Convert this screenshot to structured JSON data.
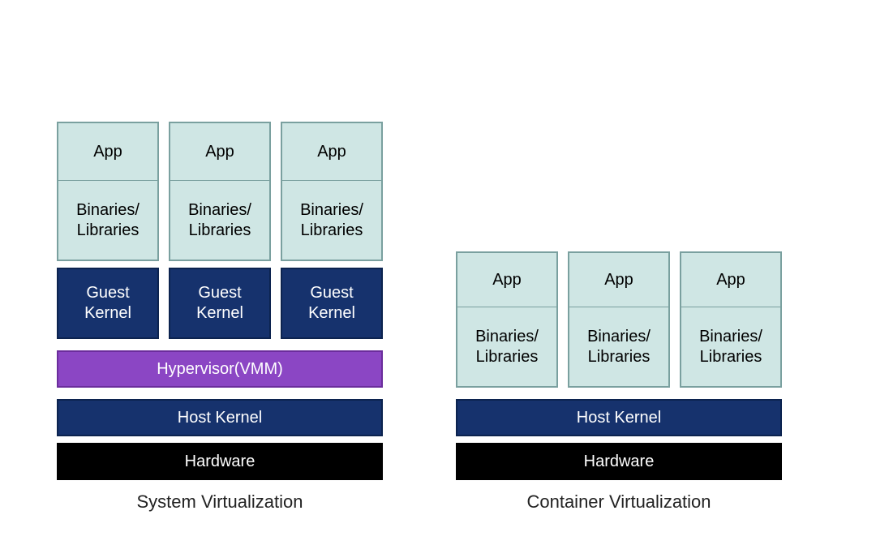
{
  "system": {
    "caption": "System Virtualization",
    "vms": [
      {
        "app": "App",
        "bin": "Binaries/\nLibraries",
        "guest": "Guest\nKernel"
      },
      {
        "app": "App",
        "bin": "Binaries/\nLibraries",
        "guest": "Guest\nKernel"
      },
      {
        "app": "App",
        "bin": "Binaries/\nLibraries",
        "guest": "Guest\nKernel"
      }
    ],
    "hypervisor": "Hypervisor(VMM)",
    "host_kernel": "Host Kernel",
    "hardware": "Hardware"
  },
  "container": {
    "caption": "Container Virtualization",
    "containers": [
      {
        "app": "App",
        "bin": "Binaries/\nLibraries"
      },
      {
        "app": "App",
        "bin": "Binaries/\nLibraries"
      },
      {
        "app": "App",
        "bin": "Binaries/\nLibraries"
      }
    ],
    "host_kernel": "Host Kernel",
    "hardware": "Hardware"
  }
}
